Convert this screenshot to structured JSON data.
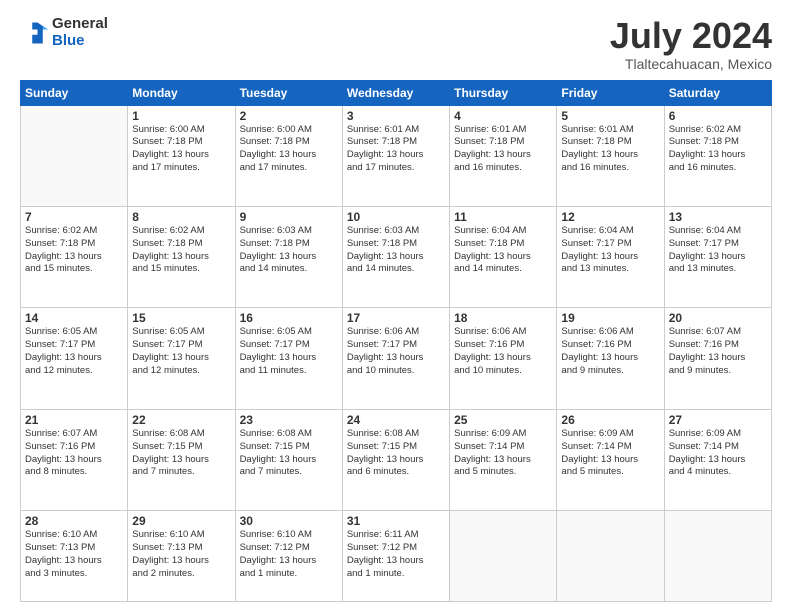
{
  "header": {
    "logo_general": "General",
    "logo_blue": "Blue",
    "title": "July 2024",
    "subtitle": "Tlaltecahuacan, Mexico"
  },
  "days_of_week": [
    "Sunday",
    "Monday",
    "Tuesday",
    "Wednesday",
    "Thursday",
    "Friday",
    "Saturday"
  ],
  "weeks": [
    [
      {
        "day": "",
        "info": ""
      },
      {
        "day": "1",
        "info": "Sunrise: 6:00 AM\nSunset: 7:18 PM\nDaylight: 13 hours\nand 17 minutes."
      },
      {
        "day": "2",
        "info": "Sunrise: 6:00 AM\nSunset: 7:18 PM\nDaylight: 13 hours\nand 17 minutes."
      },
      {
        "day": "3",
        "info": "Sunrise: 6:01 AM\nSunset: 7:18 PM\nDaylight: 13 hours\nand 17 minutes."
      },
      {
        "day": "4",
        "info": "Sunrise: 6:01 AM\nSunset: 7:18 PM\nDaylight: 13 hours\nand 16 minutes."
      },
      {
        "day": "5",
        "info": "Sunrise: 6:01 AM\nSunset: 7:18 PM\nDaylight: 13 hours\nand 16 minutes."
      },
      {
        "day": "6",
        "info": "Sunrise: 6:02 AM\nSunset: 7:18 PM\nDaylight: 13 hours\nand 16 minutes."
      }
    ],
    [
      {
        "day": "7",
        "info": "Sunrise: 6:02 AM\nSunset: 7:18 PM\nDaylight: 13 hours\nand 15 minutes."
      },
      {
        "day": "8",
        "info": "Sunrise: 6:02 AM\nSunset: 7:18 PM\nDaylight: 13 hours\nand 15 minutes."
      },
      {
        "day": "9",
        "info": "Sunrise: 6:03 AM\nSunset: 7:18 PM\nDaylight: 13 hours\nand 14 minutes."
      },
      {
        "day": "10",
        "info": "Sunrise: 6:03 AM\nSunset: 7:18 PM\nDaylight: 13 hours\nand 14 minutes."
      },
      {
        "day": "11",
        "info": "Sunrise: 6:04 AM\nSunset: 7:18 PM\nDaylight: 13 hours\nand 14 minutes."
      },
      {
        "day": "12",
        "info": "Sunrise: 6:04 AM\nSunset: 7:17 PM\nDaylight: 13 hours\nand 13 minutes."
      },
      {
        "day": "13",
        "info": "Sunrise: 6:04 AM\nSunset: 7:17 PM\nDaylight: 13 hours\nand 13 minutes."
      }
    ],
    [
      {
        "day": "14",
        "info": "Sunrise: 6:05 AM\nSunset: 7:17 PM\nDaylight: 13 hours\nand 12 minutes."
      },
      {
        "day": "15",
        "info": "Sunrise: 6:05 AM\nSunset: 7:17 PM\nDaylight: 13 hours\nand 12 minutes."
      },
      {
        "day": "16",
        "info": "Sunrise: 6:05 AM\nSunset: 7:17 PM\nDaylight: 13 hours\nand 11 minutes."
      },
      {
        "day": "17",
        "info": "Sunrise: 6:06 AM\nSunset: 7:17 PM\nDaylight: 13 hours\nand 10 minutes."
      },
      {
        "day": "18",
        "info": "Sunrise: 6:06 AM\nSunset: 7:16 PM\nDaylight: 13 hours\nand 10 minutes."
      },
      {
        "day": "19",
        "info": "Sunrise: 6:06 AM\nSunset: 7:16 PM\nDaylight: 13 hours\nand 9 minutes."
      },
      {
        "day": "20",
        "info": "Sunrise: 6:07 AM\nSunset: 7:16 PM\nDaylight: 13 hours\nand 9 minutes."
      }
    ],
    [
      {
        "day": "21",
        "info": "Sunrise: 6:07 AM\nSunset: 7:16 PM\nDaylight: 13 hours\nand 8 minutes."
      },
      {
        "day": "22",
        "info": "Sunrise: 6:08 AM\nSunset: 7:15 PM\nDaylight: 13 hours\nand 7 minutes."
      },
      {
        "day": "23",
        "info": "Sunrise: 6:08 AM\nSunset: 7:15 PM\nDaylight: 13 hours\nand 7 minutes."
      },
      {
        "day": "24",
        "info": "Sunrise: 6:08 AM\nSunset: 7:15 PM\nDaylight: 13 hours\nand 6 minutes."
      },
      {
        "day": "25",
        "info": "Sunrise: 6:09 AM\nSunset: 7:14 PM\nDaylight: 13 hours\nand 5 minutes."
      },
      {
        "day": "26",
        "info": "Sunrise: 6:09 AM\nSunset: 7:14 PM\nDaylight: 13 hours\nand 5 minutes."
      },
      {
        "day": "27",
        "info": "Sunrise: 6:09 AM\nSunset: 7:14 PM\nDaylight: 13 hours\nand 4 minutes."
      }
    ],
    [
      {
        "day": "28",
        "info": "Sunrise: 6:10 AM\nSunset: 7:13 PM\nDaylight: 13 hours\nand 3 minutes."
      },
      {
        "day": "29",
        "info": "Sunrise: 6:10 AM\nSunset: 7:13 PM\nDaylight: 13 hours\nand 2 minutes."
      },
      {
        "day": "30",
        "info": "Sunrise: 6:10 AM\nSunset: 7:12 PM\nDaylight: 13 hours\nand 1 minute."
      },
      {
        "day": "31",
        "info": "Sunrise: 6:11 AM\nSunset: 7:12 PM\nDaylight: 13 hours\nand 1 minute."
      },
      {
        "day": "",
        "info": ""
      },
      {
        "day": "",
        "info": ""
      },
      {
        "day": "",
        "info": ""
      }
    ]
  ]
}
